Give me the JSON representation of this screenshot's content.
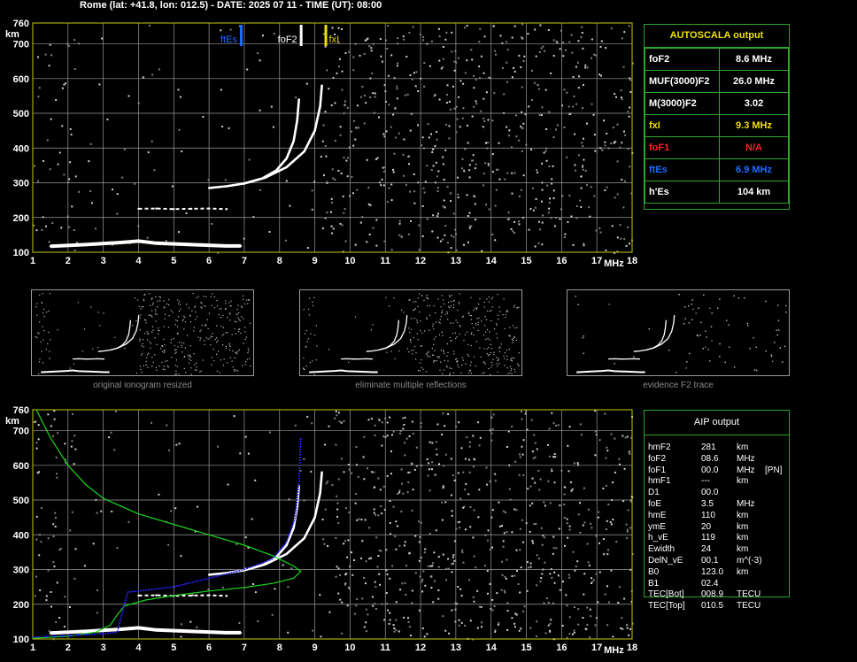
{
  "header": {
    "title": "Rome (lat: +41.8, lon: 012.5) - DATE: 2025 07 11 - TIME (UT): 08:00"
  },
  "colors": {
    "grid": "#9a9a9a",
    "frame": "#c8c800",
    "trace": "#ffffff",
    "noise": "#c8c8c8",
    "profile": "#1bd61b",
    "fit": "#2323ff",
    "ftEs": "#1e6cff",
    "foF2": "#ffffff",
    "fxI": "#f0e000",
    "foF1": "#ff2020",
    "panel_border": "#2ea52e"
  },
  "chart_data": [
    {
      "id": "ionogram-top",
      "type": "scatter",
      "title": "",
      "xlabel": "MHz",
      "ylabel": "km",
      "xlim": [
        1,
        18
      ],
      "ylim": [
        100,
        760
      ],
      "xticks": [
        "1",
        "2",
        "3",
        "4",
        "5",
        "6",
        "7",
        "8",
        "9",
        "10",
        "11",
        "12",
        "13",
        "14",
        "15",
        "16",
        "17",
        "18"
      ],
      "yticks": [
        "100",
        "200",
        "300",
        "400",
        "500",
        "600",
        "700",
        "760"
      ],
      "markers": [
        {
          "label": "ftEs",
          "x": 6.9,
          "color": "#1e6cff"
        },
        {
          "label": "foF2",
          "x": 8.6,
          "color": "#ffffff"
        },
        {
          "label": "fxI",
          "x": 9.3,
          "color": "#f0e000"
        }
      ],
      "series": [
        {
          "role": "o-trace",
          "points": [
            [
              6,
              285
            ],
            [
              6.5,
              290
            ],
            [
              7,
              298
            ],
            [
              7.5,
              312
            ],
            [
              7.9,
              335
            ],
            [
              8.2,
              370
            ],
            [
              8.4,
              420
            ],
            [
              8.5,
              480
            ],
            [
              8.55,
              540
            ]
          ]
        },
        {
          "role": "x-trace",
          "points": [
            [
              7,
              298
            ],
            [
              7.6,
              315
            ],
            [
              8.2,
              345
            ],
            [
              8.7,
              390
            ],
            [
              9.0,
              450
            ],
            [
              9.15,
              520
            ],
            [
              9.2,
              580
            ]
          ]
        },
        {
          "role": "E-layer",
          "points": [
            [
              1.5,
              117
            ],
            [
              2.5,
              122
            ],
            [
              3.5,
              128
            ],
            [
              4.0,
              132
            ],
            [
              4.5,
              126
            ],
            [
              5.5,
              122
            ],
            [
              6.5,
              118
            ],
            [
              6.9,
              118
            ]
          ]
        },
        {
          "role": "Es-multiple",
          "points": [
            [
              4,
              225
            ],
            [
              4.5,
              226
            ],
            [
              5,
              224
            ],
            [
              5.5,
              225
            ],
            [
              6,
              226
            ],
            [
              6.5,
              224
            ]
          ]
        }
      ]
    },
    {
      "id": "ionogram-bottom",
      "type": "scatter",
      "title": "",
      "xlabel": "MHz",
      "ylabel": "km",
      "xlim": [
        1,
        18
      ],
      "ylim": [
        100,
        760
      ],
      "xticks": [
        "1",
        "2",
        "3",
        "4",
        "5",
        "6",
        "7",
        "8",
        "9",
        "10",
        "11",
        "12",
        "13",
        "14",
        "15",
        "16",
        "17",
        "18"
      ],
      "yticks": [
        "100",
        "200",
        "300",
        "400",
        "500",
        "600",
        "700",
        "760"
      ],
      "series": [
        {
          "role": "o-trace",
          "points": [
            [
              6,
              285
            ],
            [
              6.5,
              290
            ],
            [
              7,
              298
            ],
            [
              7.5,
              312
            ],
            [
              7.9,
              335
            ],
            [
              8.2,
              370
            ],
            [
              8.4,
              420
            ],
            [
              8.5,
              480
            ],
            [
              8.55,
              540
            ]
          ]
        },
        {
          "role": "x-trace",
          "points": [
            [
              7,
              298
            ],
            [
              7.6,
              315
            ],
            [
              8.2,
              345
            ],
            [
              8.7,
              390
            ],
            [
              9.0,
              450
            ],
            [
              9.15,
              520
            ],
            [
              9.2,
              580
            ]
          ]
        },
        {
          "role": "E-layer",
          "points": [
            [
              1.5,
              117
            ],
            [
              2.5,
              122
            ],
            [
              3.5,
              128
            ],
            [
              4.0,
              132
            ],
            [
              4.5,
              126
            ],
            [
              5.5,
              122
            ],
            [
              6.5,
              118
            ],
            [
              6.9,
              118
            ]
          ]
        },
        {
          "role": "Es-multiple",
          "points": [
            [
              4,
              225
            ],
            [
              4.5,
              226
            ],
            [
              5,
              224
            ],
            [
              5.5,
              225
            ],
            [
              6,
              226
            ],
            [
              6.5,
              224
            ]
          ]
        },
        {
          "role": "profile",
          "points": [
            [
              1.1,
              760
            ],
            [
              1.5,
              680
            ],
            [
              2,
              600
            ],
            [
              2.5,
              545
            ],
            [
              3,
              505
            ],
            [
              4,
              460
            ],
            [
              5,
              430
            ],
            [
              6,
              400
            ],
            [
              7,
              370
            ],
            [
              7.8,
              340
            ],
            [
              8.4,
              310
            ],
            [
              8.6,
              295
            ],
            [
              8.4,
              275
            ],
            [
              7.8,
              260
            ],
            [
              7,
              248
            ],
            [
              6,
              238
            ],
            [
              5,
              225
            ],
            [
              4.2,
              212
            ],
            [
              3.6,
              195
            ],
            [
              3.4,
              170
            ],
            [
              3.2,
              140
            ],
            [
              2.8,
              120
            ],
            [
              2,
              108
            ],
            [
              1,
              102
            ]
          ]
        },
        {
          "role": "fit",
          "points": [
            [
              1,
              105
            ],
            [
              2,
              110
            ],
            [
              3,
              115
            ],
            [
              3.4,
              120
            ],
            [
              3.6,
              200
            ],
            [
              3.7,
              235
            ],
            [
              4,
              238
            ],
            [
              5,
              250
            ],
            [
              6,
              275
            ],
            [
              7,
              300
            ],
            [
              7.8,
              330
            ],
            [
              8.2,
              380
            ],
            [
              8.45,
              450
            ],
            [
              8.55,
              550
            ],
            [
              8.6,
              680
            ]
          ]
        }
      ]
    }
  ],
  "thumbnails": [
    {
      "caption": "original ionogram resized"
    },
    {
      "caption": "eliminate multiple reflections"
    },
    {
      "caption": "evidence F2 trace"
    }
  ],
  "autoscala": {
    "title": "AUTOSCALA output",
    "rows": [
      {
        "name": "foF2",
        "value": "8.6 MHz",
        "color": "#ffffff"
      },
      {
        "name": "MUF(3000)F2",
        "value": "26.0 MHz",
        "color": "#ffffff"
      },
      {
        "name": "M(3000)F2",
        "value": "3.02",
        "color": "#ffffff"
      },
      {
        "name": "fxI",
        "value": "9.3 MHz",
        "color": "#f0e000"
      },
      {
        "name": "foF1",
        "value": "N/A",
        "color": "#ff2020"
      },
      {
        "name": "ftEs",
        "value": "6.9 MHz",
        "color": "#1e6cff"
      },
      {
        "name": "h'Es",
        "value": "104    km",
        "color": "#ffffff"
      }
    ]
  },
  "aip": {
    "title": "AIP output",
    "rows": [
      {
        "name": "hmF2",
        "value": "281",
        "unit": "km",
        "extra": ""
      },
      {
        "name": "foF2",
        "value": "08.6",
        "unit": "MHz",
        "extra": ""
      },
      {
        "name": "foF1",
        "value": "00.0",
        "unit": "MHz",
        "extra": "[PN]"
      },
      {
        "name": "hmF1",
        "value": "---",
        "unit": "km",
        "extra": ""
      },
      {
        "name": "D1",
        "value": "00.0",
        "unit": "",
        "extra": ""
      },
      {
        "name": "foE",
        "value": "3.5",
        "unit": "MHz",
        "extra": ""
      },
      {
        "name": "hmE",
        "value": "110",
        "unit": "km",
        "extra": ""
      },
      {
        "name": "ymE",
        "value": "20",
        "unit": "km",
        "extra": ""
      },
      {
        "name": "h_vE",
        "value": "119",
        "unit": "km",
        "extra": ""
      },
      {
        "name": "Ewidth",
        "value": "24",
        "unit": "km",
        "extra": ""
      },
      {
        "name": "DelN_vE",
        "value": "00.1",
        "unit": "m^(-3)",
        "extra": ""
      },
      {
        "name": "B0",
        "value": "123.0",
        "unit": "km",
        "extra": ""
      },
      {
        "name": "B1",
        "value": "02.4",
        "unit": "",
        "extra": ""
      },
      {
        "name": "TEC[Bot]",
        "value": "008.9",
        "unit": "TECU",
        "extra": ""
      },
      {
        "name": "TEC[Top]",
        "value": "010.5",
        "unit": "TECU",
        "extra": ""
      }
    ]
  }
}
